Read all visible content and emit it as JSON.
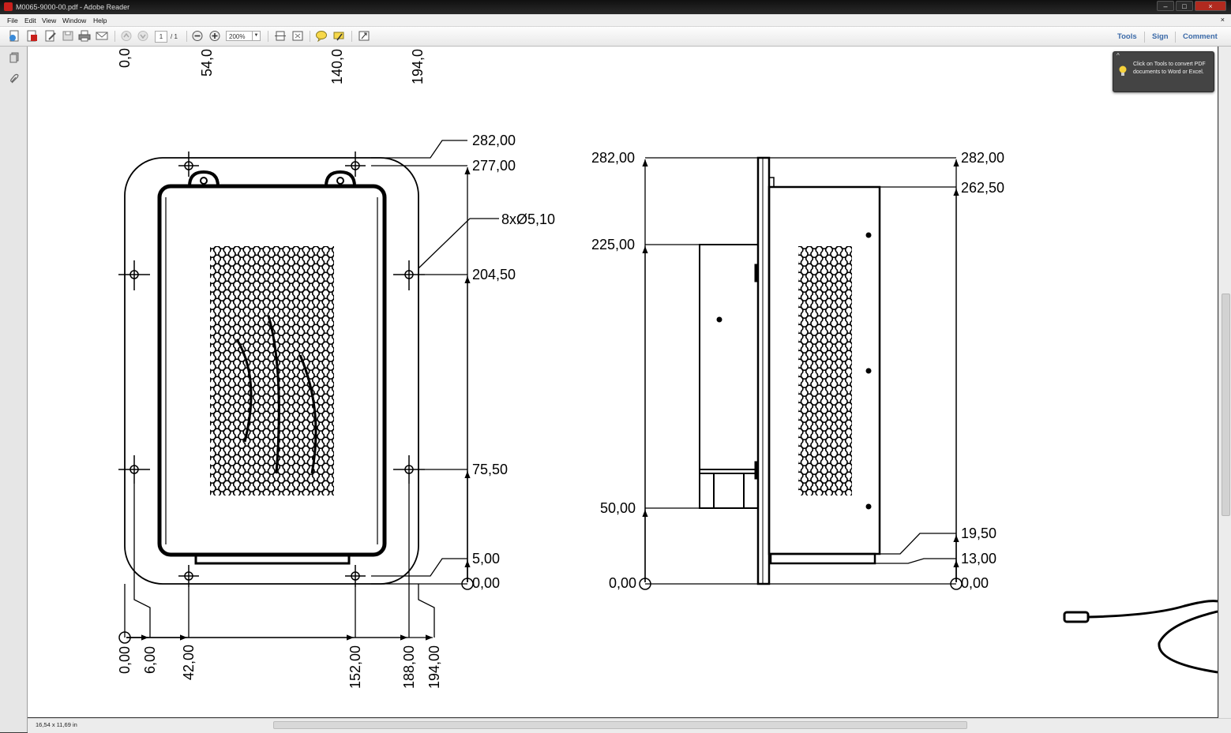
{
  "window": {
    "title": "M0065-9000-00.pdf - Adobe Reader",
    "close_label": "×",
    "max_label": "□",
    "min_label": "–"
  },
  "menu": {
    "file": "File",
    "edit": "Edit",
    "view": "View",
    "window": "Window",
    "help": "Help",
    "close_doc": "×"
  },
  "toolbar": {
    "page_current": "1",
    "page_total": "/ 1",
    "zoom": "200%",
    "tools_label": "Tools",
    "sign_label": "Sign",
    "comment_label": "Comment"
  },
  "tooltip": {
    "text": "Click on Tools to convert PDF documents to Word or Excel."
  },
  "status": {
    "page_size": "16,54 x 11,69 in"
  },
  "drawing": {
    "top_ruler": [
      "0,0",
      "54,0",
      "140,0",
      "194,0"
    ],
    "front_view": {
      "right_dims": [
        "282,00",
        "277,00",
        "204,50",
        "75,50",
        "5,00",
        "0,00"
      ],
      "hole_callout": "8xØ5,10",
      "bottom_dims": [
        "0,00",
        "6,00",
        "42,00",
        "152,00",
        "188,00",
        "194,00"
      ]
    },
    "side_view": {
      "left_dims": [
        "282,00",
        "225,00",
        "50,00",
        "0,00"
      ],
      "right_dims": [
        "282,00",
        "262,50",
        "19,50",
        "13,00",
        "0,00"
      ]
    }
  }
}
